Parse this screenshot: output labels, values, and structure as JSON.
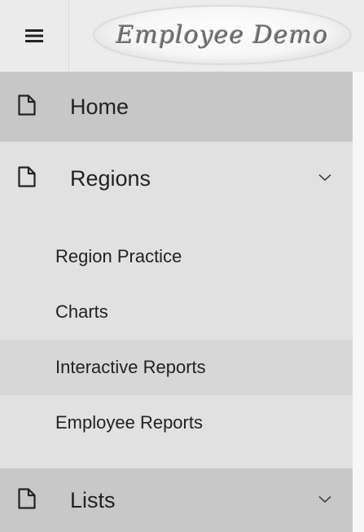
{
  "header": {
    "menu_icon": "hamburger-icon",
    "logo_text": "Employee Demo"
  },
  "nav": {
    "items": [
      {
        "label": "Home",
        "icon": "document-icon",
        "active": true
      },
      {
        "label": "Regions",
        "icon": "document-icon",
        "expanded": true,
        "chevron": "chevron-down-icon",
        "children": [
          {
            "label": "Region Practice"
          },
          {
            "label": "Charts"
          },
          {
            "label": "Interactive Reports",
            "hovered": true
          },
          {
            "label": "Employee Reports"
          }
        ]
      },
      {
        "label": "Lists",
        "icon": "document-icon",
        "chevron": "chevron-down-icon"
      }
    ]
  }
}
